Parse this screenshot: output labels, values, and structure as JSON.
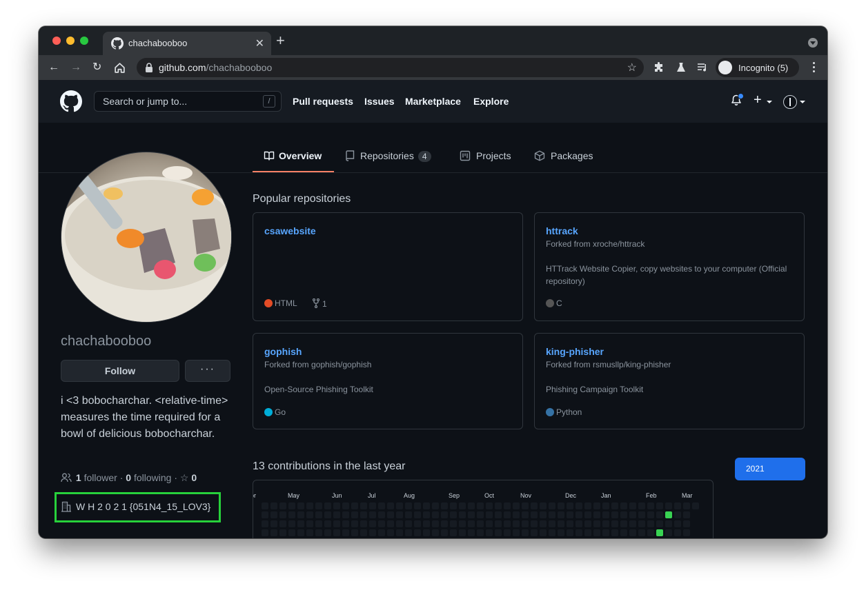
{
  "browser": {
    "tab_title": "chachabooboo",
    "url_host": "github.com",
    "url_path": "/chachabooboo",
    "incognito_label": "Incognito (5)"
  },
  "header": {
    "search_placeholder": "Search or jump to...",
    "search_shortcut": "/",
    "nav": [
      "Pull requests",
      "Issues",
      "Marketplace",
      "Explore"
    ]
  },
  "tabs": {
    "overview": "Overview",
    "repositories": "Repositories",
    "repositories_count": "4",
    "projects": "Projects",
    "packages": "Packages"
  },
  "profile": {
    "username": "chachabooboo",
    "follow_label": "Follow",
    "more_label": "···",
    "bio": "i <3 bobocharchar. <relative-time> measures the time required for a bowl of delicious bobocharchar.",
    "followers": "1",
    "followers_label": "follower",
    "following": "0",
    "following_label": "following",
    "stars": "0",
    "company": "W H 2 0 2 1 {051N4_15_LOV3}"
  },
  "popular": {
    "title": "Popular repositories",
    "repos": [
      {
        "name": "csawebsite",
        "fork": "",
        "desc": "",
        "lang": "HTML",
        "lang_color": "#e34c26",
        "forks": "1"
      },
      {
        "name": "httrack",
        "fork": "Forked from xroche/httrack",
        "desc": "HTTrack Website Copier, copy websites to your computer (Official repository)",
        "lang": "C",
        "lang_color": "#555555",
        "forks": ""
      },
      {
        "name": "gophish",
        "fork": "Forked from gophish/gophish",
        "desc": "Open-Source Phishing Toolkit",
        "lang": "Go",
        "lang_color": "#00add8",
        "forks": ""
      },
      {
        "name": "king-phisher",
        "fork": "Forked from rsmusllp/king-phisher",
        "desc": "Phishing Campaign Toolkit",
        "lang": "Python",
        "lang_color": "#3572a5",
        "forks": ""
      }
    ]
  },
  "contributions": {
    "title": "13 contributions in the last year",
    "year": "2021",
    "months": [
      "Apr",
      "May",
      "Jun",
      "Jul",
      "Aug",
      "Sep",
      "Oct",
      "Nov",
      "Dec",
      "Jan",
      "Feb",
      "Mar"
    ]
  }
}
